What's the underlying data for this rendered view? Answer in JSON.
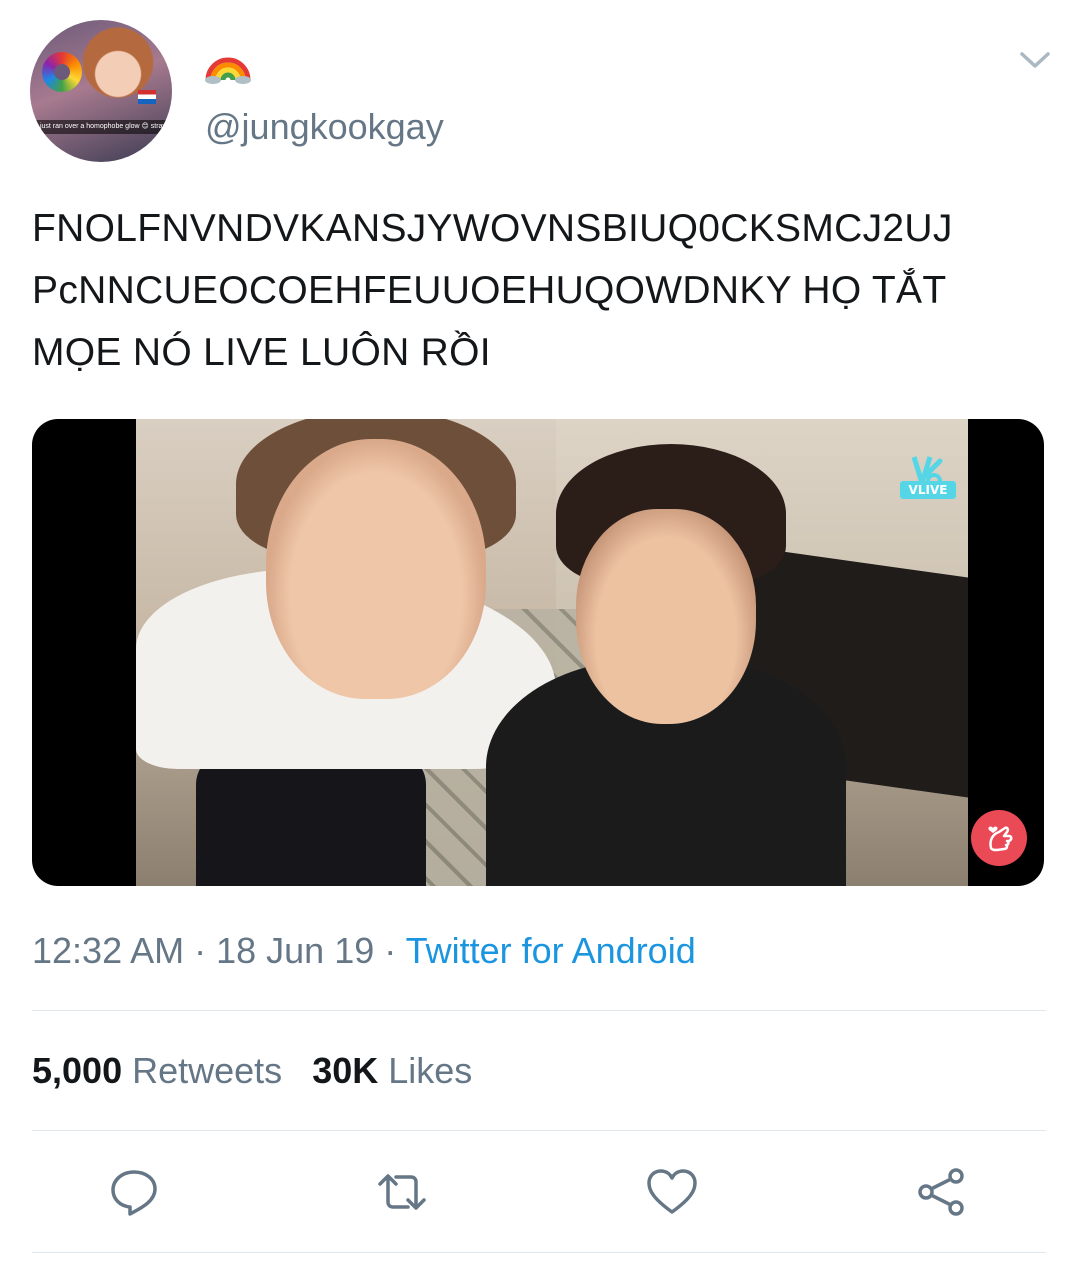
{
  "tweet": {
    "display_name_emoji": "rainbow-flag-emoji",
    "handle": "@jungkookgay",
    "avatar_caption": "I just ran over a homophobe glow 😊 stray",
    "text_lines": [
      "FNOLFNVNDVKANSJYWOVNSBIUQ0CKSMCJ2UJ",
      "PcNNCUEOCOEHFEUUOEHUQOWDNKY HỌ TẮT",
      "MỌE NÓ LIVE LUÔN RỒI"
    ],
    "media": {
      "watermark": "VLIVE"
    },
    "time": "12:32 AM",
    "separator": " · ",
    "date": "18 Jun 19",
    "source": "Twitter for Android",
    "retweets_count": "5,000",
    "retweets_label": "Retweets",
    "likes_count": "30K",
    "likes_label": "Likes"
  },
  "icons": {
    "caret": "chevron-down-icon",
    "reply": "reply-icon",
    "retweet": "retweet-icon",
    "like": "heart-icon",
    "share": "share-icon"
  },
  "colors": {
    "text": "#14171a",
    "secondary": "#657786",
    "link": "#1b95e0",
    "divider": "#e1e8ed",
    "vlive": "#54d6e6",
    "heart_button": "#ea4a55"
  }
}
